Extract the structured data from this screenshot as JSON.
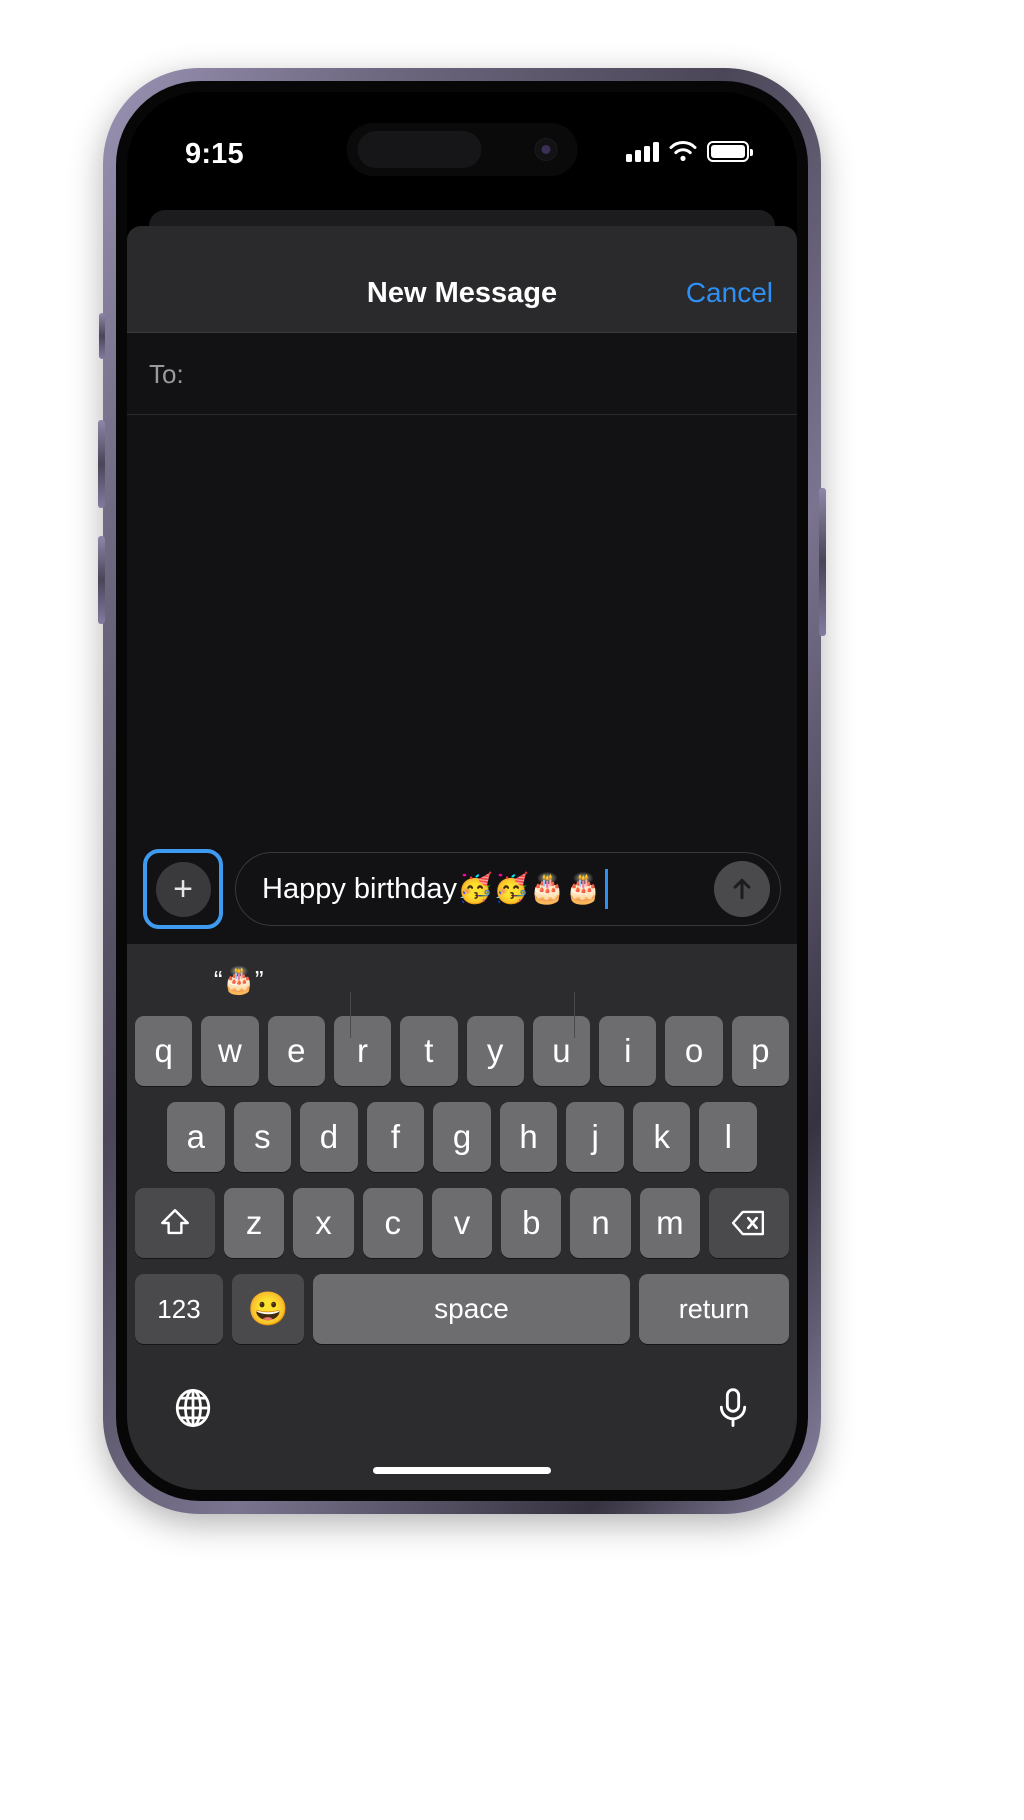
{
  "device": {
    "name": "iphone-14-pro",
    "frame_color": "#6e6880"
  },
  "status_bar": {
    "time": "9:15",
    "signal_icon": "cellular-signal-icon",
    "wifi_icon": "wifi-icon",
    "battery_icon": "battery-full-icon",
    "dynamic_island": "dynamic-island"
  },
  "nav": {
    "title": "New Message",
    "cancel_label": "Cancel",
    "cancel_color": "#2e90f5"
  },
  "recipients": {
    "to_label": "To:",
    "to_value": "",
    "to_placeholder": ""
  },
  "composer": {
    "plus_label": "+",
    "plus_focused": true,
    "focus_ring_color": "#3f9bf0",
    "message_value": "Happy birthday🥳🥳🎂🎂",
    "message_placeholder": "iMessage",
    "caret_color": "#2e90f5",
    "send_icon": "send-arrow-up-icon"
  },
  "keyboard": {
    "suggestions": [
      "“🎂”",
      "",
      ""
    ],
    "row1": [
      "q",
      "w",
      "e",
      "r",
      "t",
      "y",
      "u",
      "i",
      "o",
      "p"
    ],
    "row2": [
      "a",
      "s",
      "d",
      "f",
      "g",
      "h",
      "j",
      "k",
      "l"
    ],
    "row3": [
      "z",
      "x",
      "c",
      "v",
      "b",
      "n",
      "m"
    ],
    "shift_icon": "shift-arrow-up-icon",
    "delete_icon": "backspace-delete-icon",
    "numbers_label": "123",
    "emoji_label": "😀",
    "space_label": "space",
    "return_label": "return",
    "globe_icon": "globe-language-icon",
    "mic_icon": "microphone-dictation-icon",
    "key_color": "#6d6d70",
    "key_dark_color": "#4a4a4d",
    "keyboard_bg": "#2c2c2e"
  },
  "home_indicator": "home-indicator-bar"
}
